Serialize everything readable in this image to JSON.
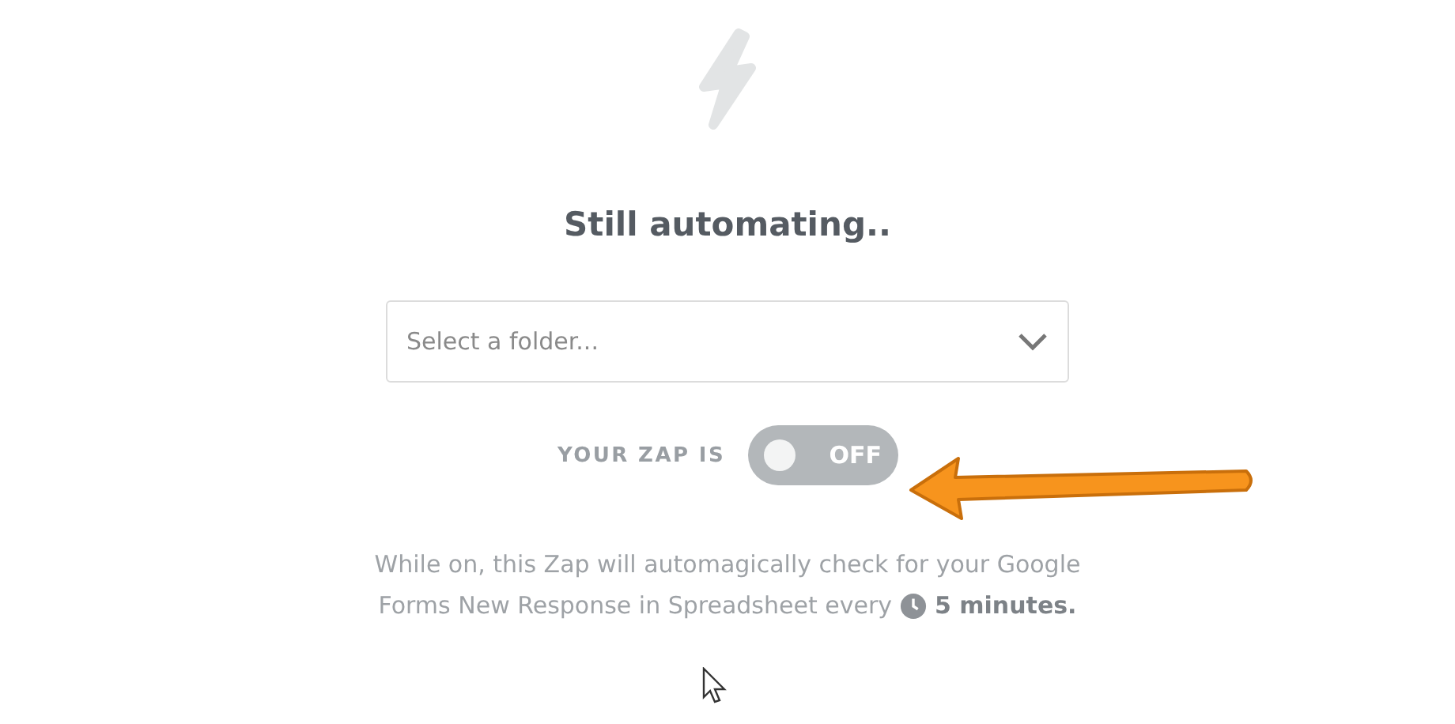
{
  "title": "Still automating..",
  "folder_select": {
    "placeholder": "Select a folder..."
  },
  "zap_toggle": {
    "label": "YOUR ZAP IS",
    "state_text": "OFF",
    "on": false
  },
  "description": {
    "lines": [
      "While on, this Zap will automagically check for your Google",
      "Forms New Response in Spreadsheet every"
    ],
    "interval": "5 minutes."
  }
}
